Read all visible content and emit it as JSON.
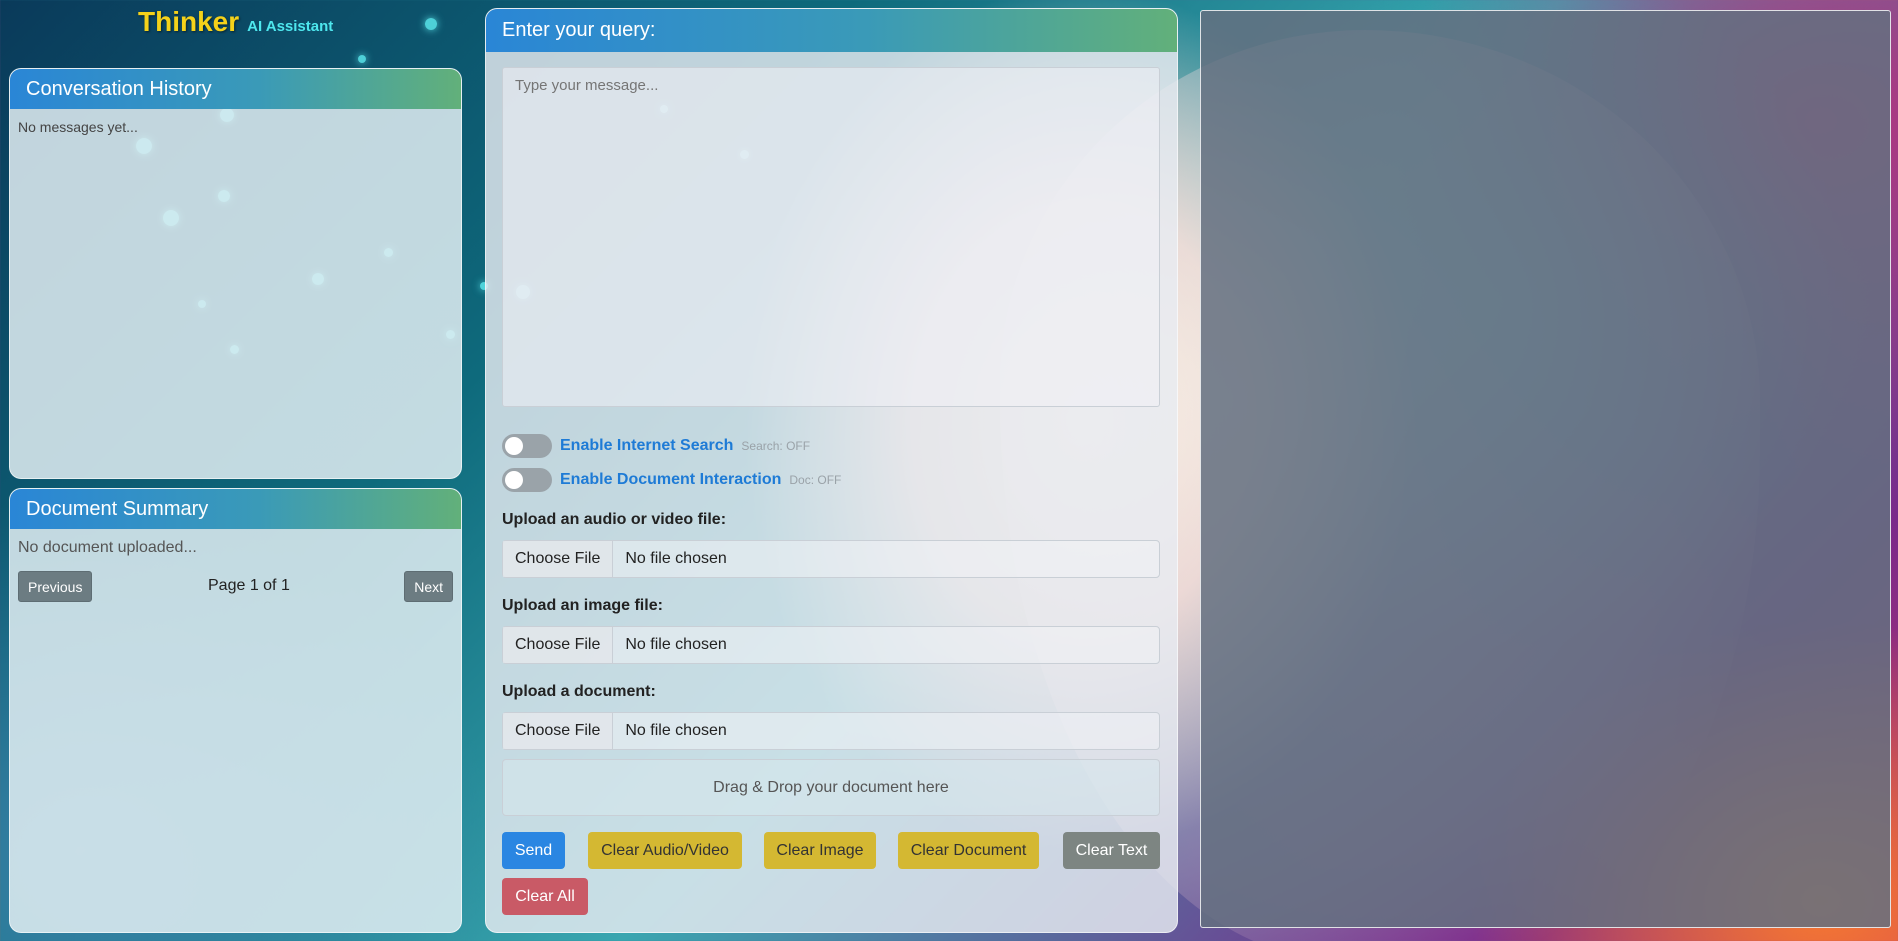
{
  "app": {
    "name": "Thinker",
    "subtitle": "AI Assistant"
  },
  "conversation_history": {
    "title": "Conversation History",
    "empty_text": "No messages yet..."
  },
  "document_summary": {
    "title": "Document Summary",
    "empty_text": "No document uploaded...",
    "pager": {
      "previous_label": "Previous",
      "page_info": "Page 1 of 1",
      "next_label": "Next"
    }
  },
  "query": {
    "title": "Enter your query:",
    "message_placeholder": "Type your message...",
    "toggles": [
      {
        "label": "Enable Internet Search",
        "status": "Search: OFF",
        "on": false
      },
      {
        "label": "Enable Document Interaction",
        "status": "Doc: OFF",
        "on": false
      }
    ],
    "uploads": [
      {
        "label": "Upload an audio or video file:",
        "button": "Choose File",
        "value": "No file chosen"
      },
      {
        "label": "Upload an image file:",
        "button": "Choose File",
        "value": "No file chosen"
      },
      {
        "label": "Upload a document:",
        "button": "Choose File",
        "value": "No file chosen"
      }
    ],
    "dropzone_text": "Drag & Drop your document here",
    "buttons": {
      "send": "Send",
      "clear_audio_video": "Clear Audio/Video",
      "clear_image": "Clear Image",
      "clear_document": "Clear Document",
      "clear_text": "Clear Text",
      "clear_all": "Clear All"
    }
  },
  "colors": {
    "brand": "#f5d21a",
    "accent": "#2a86e2",
    "toggle_label": "#1e7bd6",
    "clear_warning": "#d4b832",
    "clear_all": "#c95a66"
  }
}
